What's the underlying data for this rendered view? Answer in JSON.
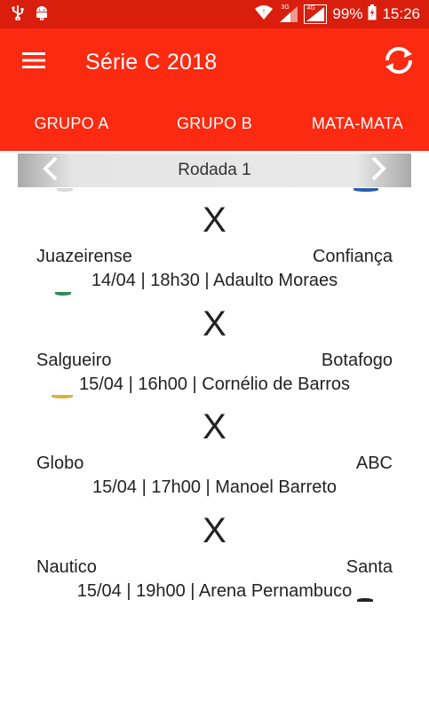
{
  "status_bar": {
    "network_3g": "3G",
    "network_4g": "4G",
    "battery": "99%",
    "time": "15:26"
  },
  "toolbar": {
    "title": "Série C 2018"
  },
  "tabs": [
    {
      "label": "GRUPO A"
    },
    {
      "label": "GRUPO B"
    },
    {
      "label": "MATA-MATA"
    }
  ],
  "round": {
    "label": "Rodada 1"
  },
  "matches": [
    {
      "vs": "X",
      "home": "Juazeirense",
      "away": "Confiança",
      "info": "14/04 | 18h30 | Adaulto Moraes"
    },
    {
      "vs": "X",
      "home": "Salgueiro",
      "away": "Botafogo",
      "info": "15/04 | 16h00 | Cornélio de Barros"
    },
    {
      "vs": "X",
      "home": "Globo",
      "away": "ABC",
      "info": "15/04 | 17h00 | Manoel Barreto"
    },
    {
      "vs": "X",
      "home": "Nautico",
      "away": "Santa",
      "info": "15/04 | 19h00 | Arena Pernambuco"
    }
  ],
  "colors": {
    "status_bar": "#d91e0e",
    "app_bar": "#fc2a10",
    "text": "#222222"
  }
}
